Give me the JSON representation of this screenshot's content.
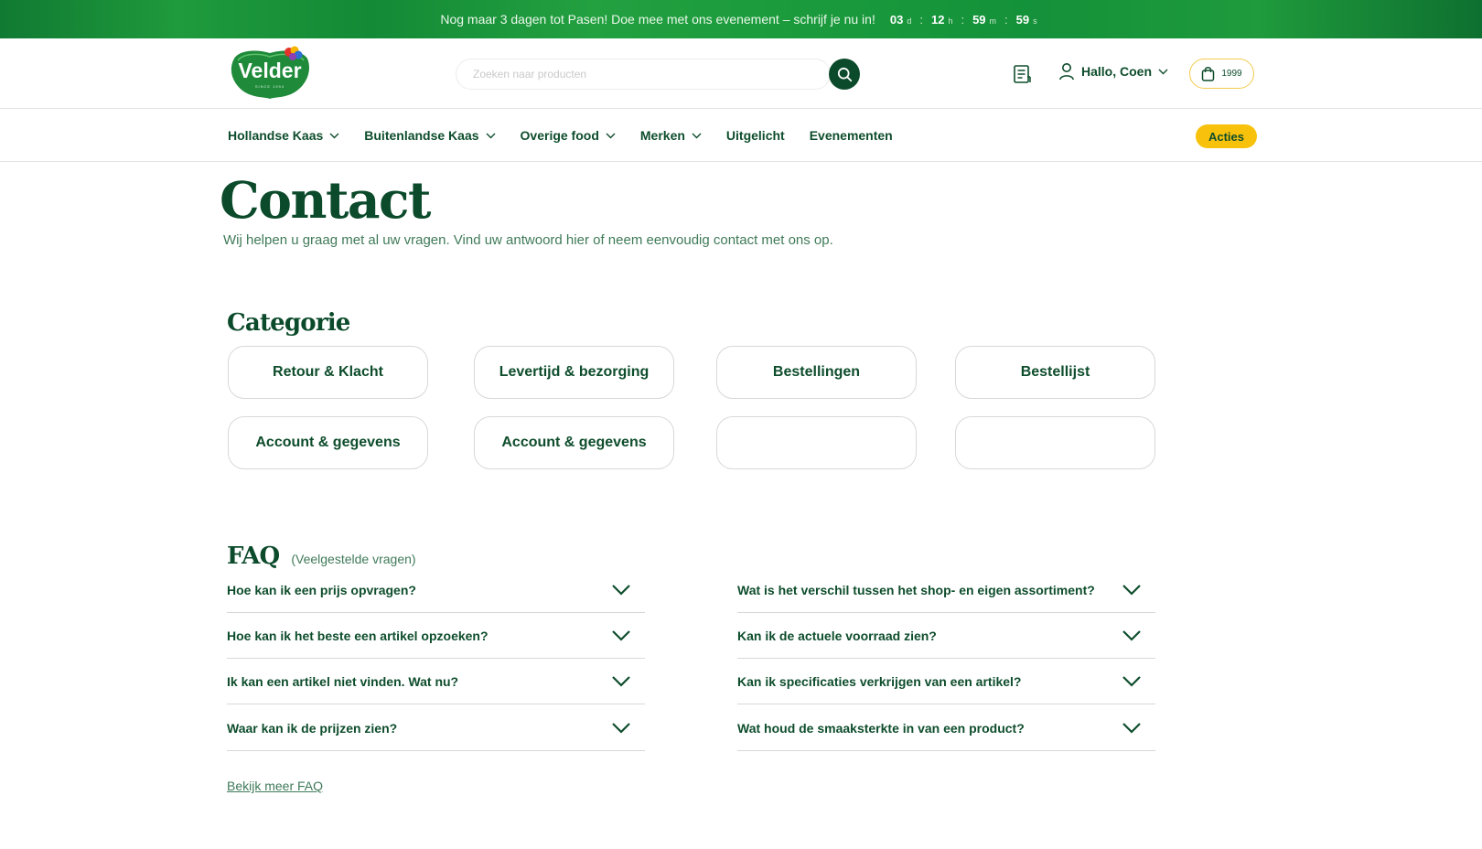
{
  "promo": {
    "message": "Nog maar 3 dagen tot Pasen! Doe mee met ons evenement – schrijf je nu in!",
    "countdown": {
      "days": "03",
      "days_unit": "d",
      "hours": "12",
      "hours_unit": "h",
      "minutes": "59",
      "minutes_unit": "m",
      "seconds": "59",
      "seconds_unit": "s",
      "separator": ":"
    }
  },
  "header": {
    "logo_text": "Velder",
    "logo_tagline": "SINCE 1994",
    "search_placeholder": "Zoeken naar producten",
    "user_greeting": "Hallo, Coen",
    "cart_value": "1999"
  },
  "nav": {
    "items": [
      {
        "label": "Hollandse Kaas",
        "dropdown": true
      },
      {
        "label": "Buitenlandse Kaas",
        "dropdown": true
      },
      {
        "label": "Overige food",
        "dropdown": true
      },
      {
        "label": "Merken",
        "dropdown": true
      },
      {
        "label": "Uitgelicht",
        "dropdown": false
      },
      {
        "label": "Evenementen",
        "dropdown": false
      }
    ],
    "acties_label": "Acties"
  },
  "page": {
    "title": "Contact",
    "subtitle": "Wij helpen u graag met al uw vragen. Vind uw antwoord hier of neem eenvoudig contact met ons op."
  },
  "categories": {
    "title": "Categorie",
    "items": [
      "Retour & Klacht",
      "Levertijd & bezorging",
      "Bestellingen",
      "Bestellijst",
      "Account & gegevens",
      "Account & gegevens",
      "",
      ""
    ]
  },
  "faq": {
    "title": "FAQ",
    "subtitle": "(Veelgestelde vragen)",
    "left": [
      "Hoe kan ik een prijs opvragen?",
      "Hoe kan ik het beste een artikel opzoeken?",
      "Ik kan een artikel niet vinden. Wat nu?",
      "Waar kan ik de prijzen zien?"
    ],
    "right": [
      "Wat is het verschil tussen het shop- en eigen assortiment?",
      "Kan ik de actuele voorraad zien?",
      "Kan ik specificaties verkrijgen van een artikel?",
      "Wat houd de smaaksterkte in van een product?"
    ],
    "more_link": "Bekijk meer FAQ"
  },
  "colors": {
    "brand_green": "#0b4a2a",
    "promo_green": "#1a9a3c",
    "accent_yellow": "#f8c20c",
    "cart_border": "#f2cb4e"
  },
  "icons": {
    "search": "search-icon",
    "order_list": "order-list-icon",
    "user": "user-icon",
    "cart": "shopping-bag-icon",
    "dropdown": "chevron-down-icon"
  }
}
